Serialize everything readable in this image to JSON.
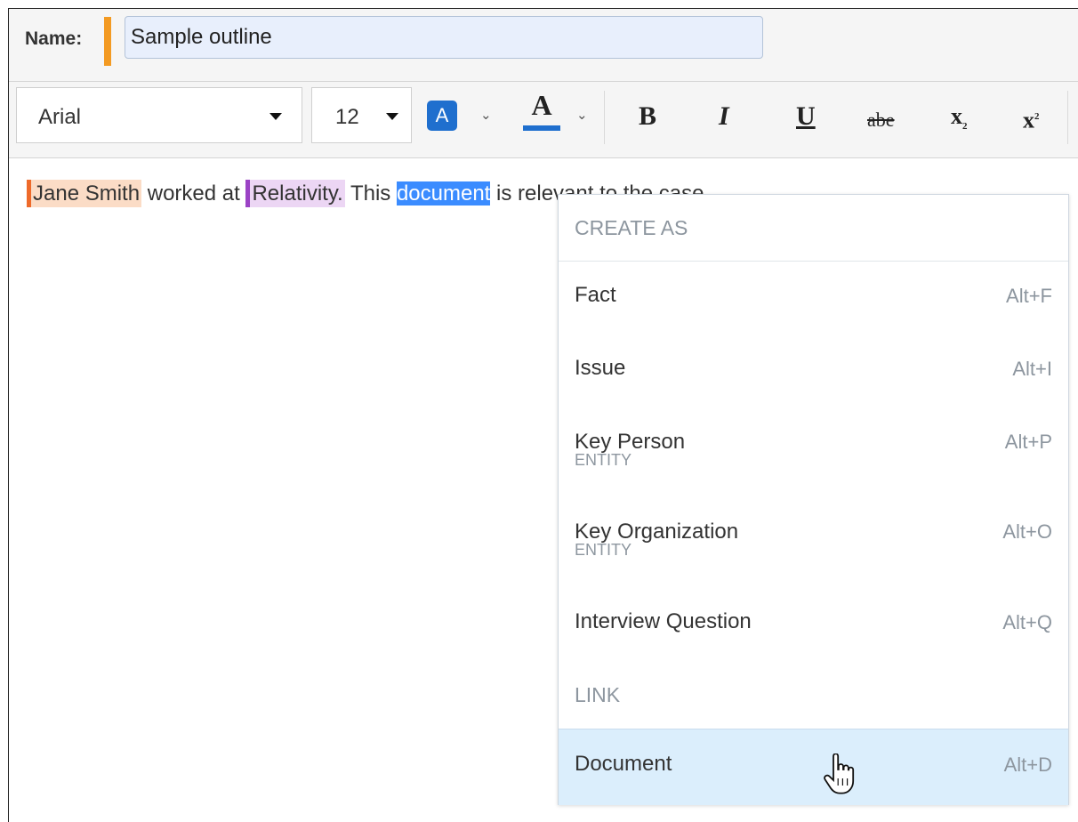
{
  "name_bar": {
    "label": "Name:",
    "value": "Sample outline",
    "marker_color": "#f39a22"
  },
  "toolbar": {
    "font_family": "Arial",
    "font_size": "12",
    "highlight_letter": "A",
    "font_color_letter": "A",
    "bold": "B",
    "italic": "I",
    "underline": "U",
    "strikethrough": "abe",
    "subscript": "x",
    "subscript_mark": "2",
    "superscript": "x",
    "superscript_mark": "2",
    "accent_color": "#1f6fce"
  },
  "editor": {
    "person": "Jane Smith",
    "text1": " worked at ",
    "org": "Relativity.",
    "text2": "  This ",
    "selected": "document",
    "text3": " is relevant to the case."
  },
  "menu": {
    "section_create": "CREATE AS",
    "items": [
      {
        "label": "Fact",
        "shortcut": "Alt+F"
      },
      {
        "label": "Issue",
        "shortcut": "Alt+I"
      },
      {
        "label": "Key Person",
        "sub": "ENTITY",
        "shortcut": "Alt+P"
      },
      {
        "label": "Key Organization",
        "sub": "ENTITY",
        "shortcut": "Alt+O"
      },
      {
        "label": "Interview Question",
        "shortcut": "Alt+Q"
      }
    ],
    "section_link": "LINK",
    "link_items": [
      {
        "label": "Document",
        "shortcut": "Alt+D"
      }
    ]
  },
  "icons": {
    "dropdown": "caret-down-icon",
    "chevron": "chevron-down-icon",
    "cursor": "hand-pointer-icon"
  }
}
